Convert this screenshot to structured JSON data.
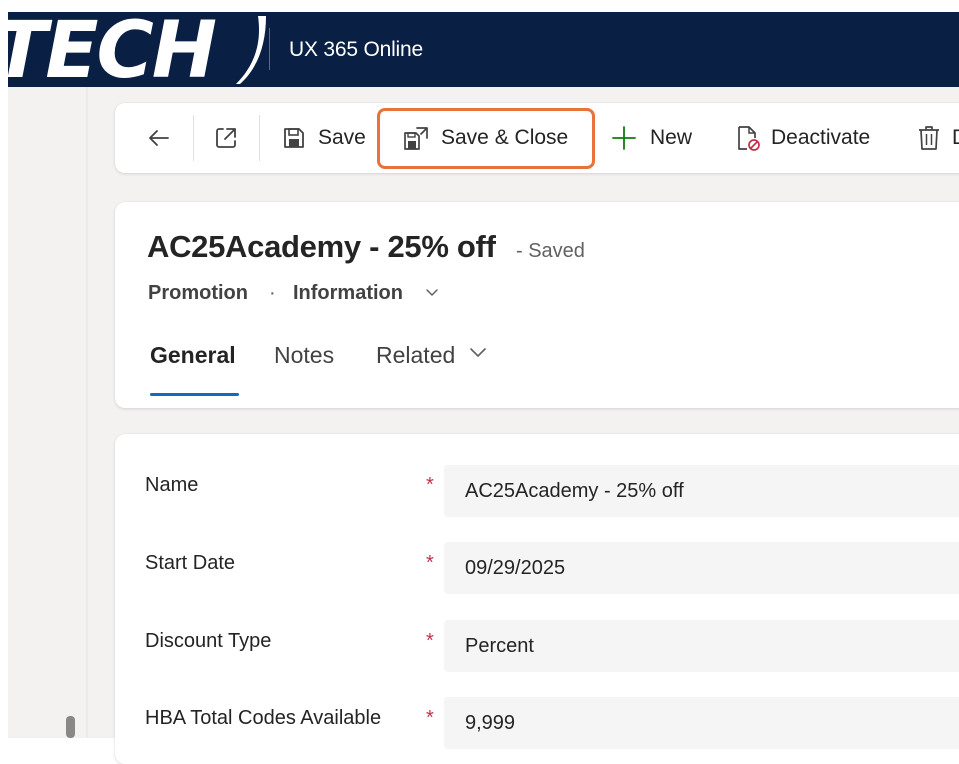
{
  "header": {
    "logo_text": "TECH",
    "app_title": "UX 365 Online"
  },
  "toolbar": {
    "back_label": "",
    "save_label": "Save",
    "save_close_label": "Save & Close",
    "new_label": "New",
    "deactivate_label": "Deactivate",
    "delete_label": "D"
  },
  "record": {
    "title": "AC25Academy - 25% off",
    "status": "- Saved",
    "entity": "Promotion",
    "separator": "·",
    "form_name": "Information"
  },
  "tabs": [
    {
      "label": "General",
      "active": true
    },
    {
      "label": "Notes",
      "active": false
    },
    {
      "label": "Related",
      "active": false
    }
  ],
  "fields": [
    {
      "label": "Name",
      "required": "*",
      "value": "AC25Academy - 25% off"
    },
    {
      "label": "Start Date",
      "required": "*",
      "value": "09/29/2025"
    },
    {
      "label": "Discount Type",
      "required": "*",
      "value": "Percent"
    },
    {
      "label": "HBA Total Codes Available",
      "required": "*",
      "value": "9,999"
    }
  ],
  "colors": {
    "header_bg": "#0a1f44",
    "highlight": "#e8733a",
    "accent": "#0f6cbd",
    "required": "#c4314b"
  }
}
